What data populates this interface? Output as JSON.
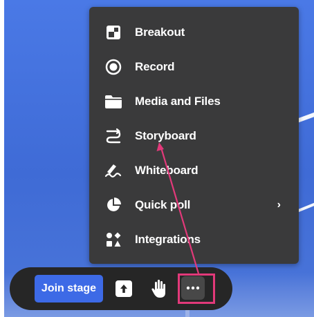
{
  "menu": {
    "items": [
      {
        "label": "Breakout",
        "icon": "breakout-icon"
      },
      {
        "label": "Record",
        "icon": "record-icon"
      },
      {
        "label": "Media and Files",
        "icon": "folder-icon"
      },
      {
        "label": "Storyboard",
        "icon": "storyboard-icon"
      },
      {
        "label": "Whiteboard",
        "icon": "whiteboard-icon"
      },
      {
        "label": "Quick poll",
        "icon": "pie-chart-icon",
        "has_submenu": true,
        "chevron": "›"
      },
      {
        "label": "Integrations",
        "icon": "integrations-icon"
      }
    ]
  },
  "toolbar": {
    "join_label": "Join stage",
    "upload_icon": "upload-icon",
    "hand_icon": "raise-hand-icon",
    "more_icon": "more-dots-icon"
  },
  "colors": {
    "accent": "#3d6ae6",
    "menu_bg": "#3a3a3b",
    "toolbar_bg": "#262626",
    "annotation": "#e2397a",
    "background": "#4a79e6"
  }
}
